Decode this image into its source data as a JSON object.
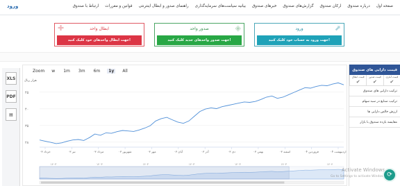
{
  "nav": {
    "brand": "ورود",
    "items": [
      "صفحه اول",
      "درباره صندوق",
      "ارکان صندوق",
      "گزارش‌های صندوق",
      "خبرهای صندوق",
      "بیانیه سیاست‌های سرمایه‌گذاری",
      "راهنمای صدور و ابطال اینترنتی",
      "قوانین و مقررات",
      "ارتباط با صندوق"
    ]
  },
  "cards": {
    "redeem": {
      "title": "ابطال واحد",
      "action": "جهت ابطال واحدهای خود کلیک کنید!"
    },
    "issue": {
      "title": "صدور واحد",
      "action": "جهت صدور واحدهای جدید کلیک کنید!"
    },
    "login": {
      "title": "ورود",
      "action": "جهت ورود به حساب خود کلیک کنید!"
    }
  },
  "chart_toolbar": {
    "zoom_label": "Zoom",
    "ranges": [
      "w",
      "1m",
      "3m",
      "6m",
      "1y",
      "All"
    ],
    "active": "1y"
  },
  "tools": [
    "xls-icon",
    "pdf-icon",
    "print-icon"
  ],
  "tool_labels": [
    "XLS",
    "PDF",
    "▤"
  ],
  "sidebar": {
    "title": "قیمت دارایی های صندوق",
    "columns": [
      "قیمت ابطال",
      "قیمت صدور",
      "قیمت آماری"
    ],
    "items": [
      "ترکیب دارایی های صندوق",
      "ترکیب صنایع در سبد سهام",
      "ارزش خالص دارایی ها",
      "مقایسه بازده صندوق با بازار"
    ]
  },
  "watermark": {
    "line1": "Activate Windows",
    "line2": "Go to Settings to activate Windows."
  },
  "chart_data": {
    "type": "line",
    "ylabel": "هزار ریال",
    "ylim": [
      2800,
      5600
    ],
    "yticks": [
      "۲۸",
      "۳۵",
      "۴۰",
      "۴۵"
    ],
    "xticks": [
      "خرداد ۰۳",
      "تیر ۰۳",
      "مرداد ۰۳",
      "شهریور ۰۳",
      "مهر ۰۳",
      "آبان ۰۳",
      "آذر ۰۳",
      "دی ۰۳",
      "بهمن ۰۳",
      "اسفند ۰۳",
      "فروردین ۰۴",
      "اردیبهشت ۰۴"
    ],
    "navigator_ticks": [
      "۱۴۰۳",
      "۱۴۰۳",
      "۱۴۰۳",
      "۱۴۰۳",
      "۱۴۰۳",
      "۱۴۰۳",
      "۱۴۰۴"
    ],
    "series": [
      {
        "values": [
          3100,
          3050,
          3000,
          2950,
          2980,
          3050,
          3100,
          3120,
          3080,
          3200,
          3350,
          3300,
          3400,
          3380,
          3450,
          3500,
          3480,
          3460,
          3520,
          3600,
          3700,
          3900,
          4000,
          4050,
          3950,
          3850,
          3800,
          3900,
          4100,
          4300,
          4400,
          4450,
          4420,
          4500,
          4550,
          4600,
          4650,
          4700,
          4680,
          4720,
          4800,
          4900,
          4950,
          4850,
          4900,
          5000,
          5100,
          5200,
          5300,
          5280,
          5350,
          5400,
          5380,
          5450,
          5500,
          5420
        ]
      }
    ]
  }
}
